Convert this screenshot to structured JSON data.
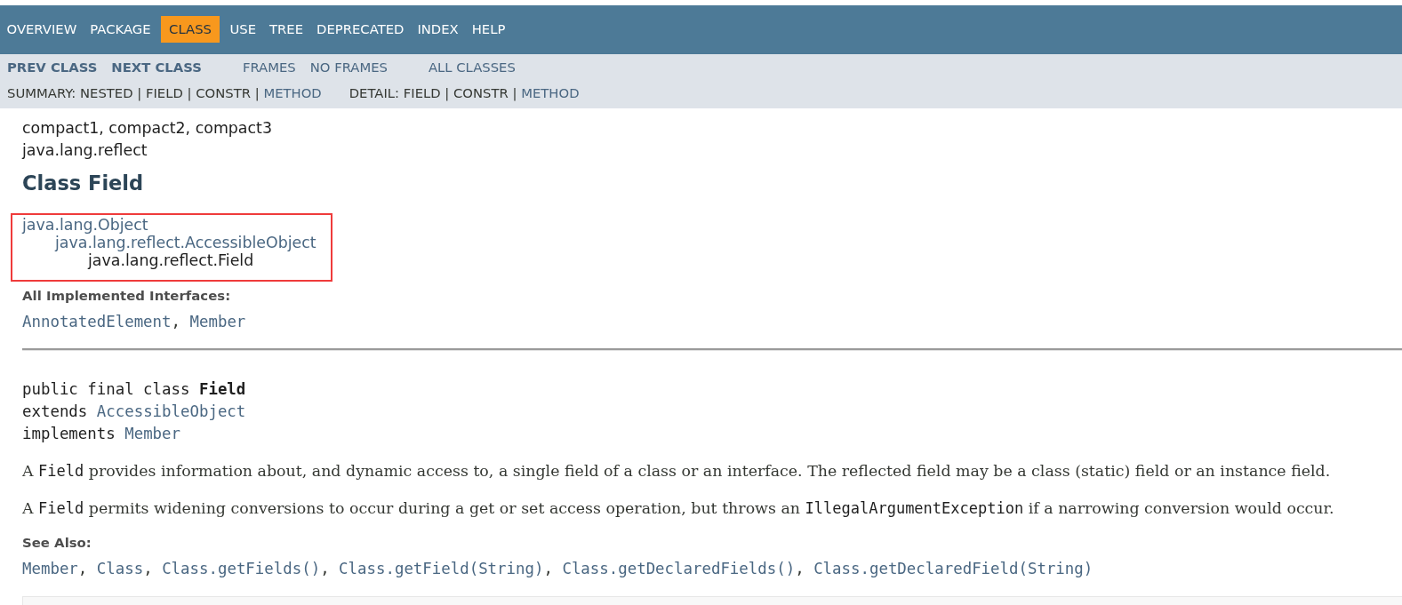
{
  "top_nav": {
    "items": [
      {
        "label": "OVERVIEW",
        "selected": false
      },
      {
        "label": "PACKAGE",
        "selected": false
      },
      {
        "label": "CLASS",
        "selected": true
      },
      {
        "label": "USE",
        "selected": false
      },
      {
        "label": "TREE",
        "selected": false
      },
      {
        "label": "DEPRECATED",
        "selected": false
      },
      {
        "label": "INDEX",
        "selected": false
      },
      {
        "label": "HELP",
        "selected": false
      }
    ]
  },
  "sub_nav": {
    "class_links": [
      "PREV CLASS",
      "NEXT CLASS"
    ],
    "frame_links": [
      "FRAMES",
      "NO FRAMES"
    ],
    "all_classes": "ALL CLASSES",
    "summary": {
      "text": "SUMMARY: NESTED | FIELD | CONSTR |",
      "links": [
        "METHOD"
      ]
    },
    "detail": {
      "text": "DETAIL: FIELD | CONSTR |",
      "links": [
        "METHOD"
      ]
    }
  },
  "profiles": "compact1, compact2, compact3",
  "package": "java.lang.reflect",
  "title": "Class Field",
  "inheritance": {
    "highlighted": true,
    "tree": [
      {
        "label": "java.lang.Object",
        "link": true,
        "children": [
          {
            "label": "java.lang.reflect.AccessibleObject",
            "link": true,
            "children": [
              {
                "label": "java.lang.reflect.Field",
                "link": false
              }
            ]
          }
        ]
      }
    ]
  },
  "interfaces": {
    "heading": "All Implemented Interfaces:",
    "links": [
      {
        "label": "AnnotatedElement",
        "after": ","
      },
      {
        "label": "Member"
      }
    ]
  },
  "signature": [
    {
      "text": "public final class **Field**"
    },
    {
      "text": "extends",
      "links": [
        "AccessibleObject"
      ]
    },
    {
      "text": "implements",
      "links": [
        "Member"
      ]
    }
  ],
  "description": [
    "A **Field** provides information about, and dynamic access to, a single field of a class or an interface. The reflected field may be a class (static) field or an instance field.",
    "A **Field** permits widening conversions to occur during a get or set access operation, but throws an **IllegalArgumentException** if a narrowing conversion would occur."
  ],
  "see_also": {
    "heading": "See Also:",
    "links": [
      {
        "label": "Member",
        "after": ","
      },
      {
        "label": "Class",
        "after": ","
      },
      {
        "label": "Class.getFields()",
        "after": ","
      },
      {
        "label": "Class.getField(String)",
        "after": ","
      },
      {
        "label": "Class.getDeclaredFields()",
        "after": ","
      },
      {
        "label": "Class.getDeclaredField(String)"
      }
    ]
  }
}
